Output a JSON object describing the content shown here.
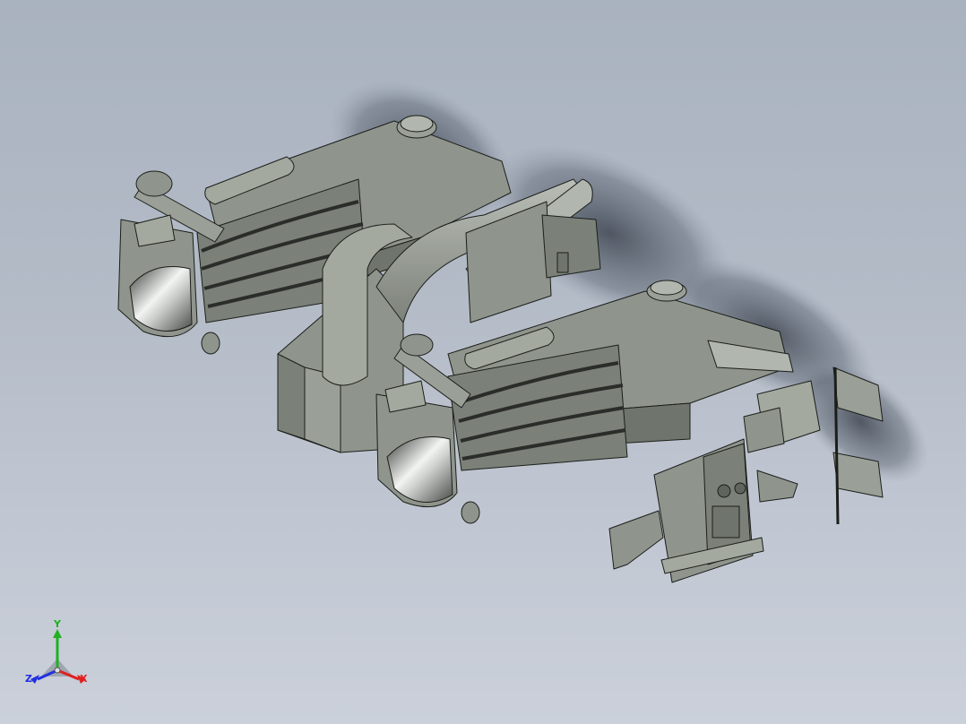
{
  "viewport": {
    "background_top": "#a9b2bf",
    "background_bottom": "#cbd0da"
  },
  "model": {
    "body_color": "#8f958c",
    "shade_color": "#6f746c",
    "edge_color": "#1c1e1a",
    "shadow_color": "#4a515c"
  },
  "triad": {
    "x_label": "X",
    "y_label": "Y",
    "z_label": "Z",
    "x_color": "#e02020",
    "y_color": "#20b020",
    "z_color": "#2030e0"
  }
}
